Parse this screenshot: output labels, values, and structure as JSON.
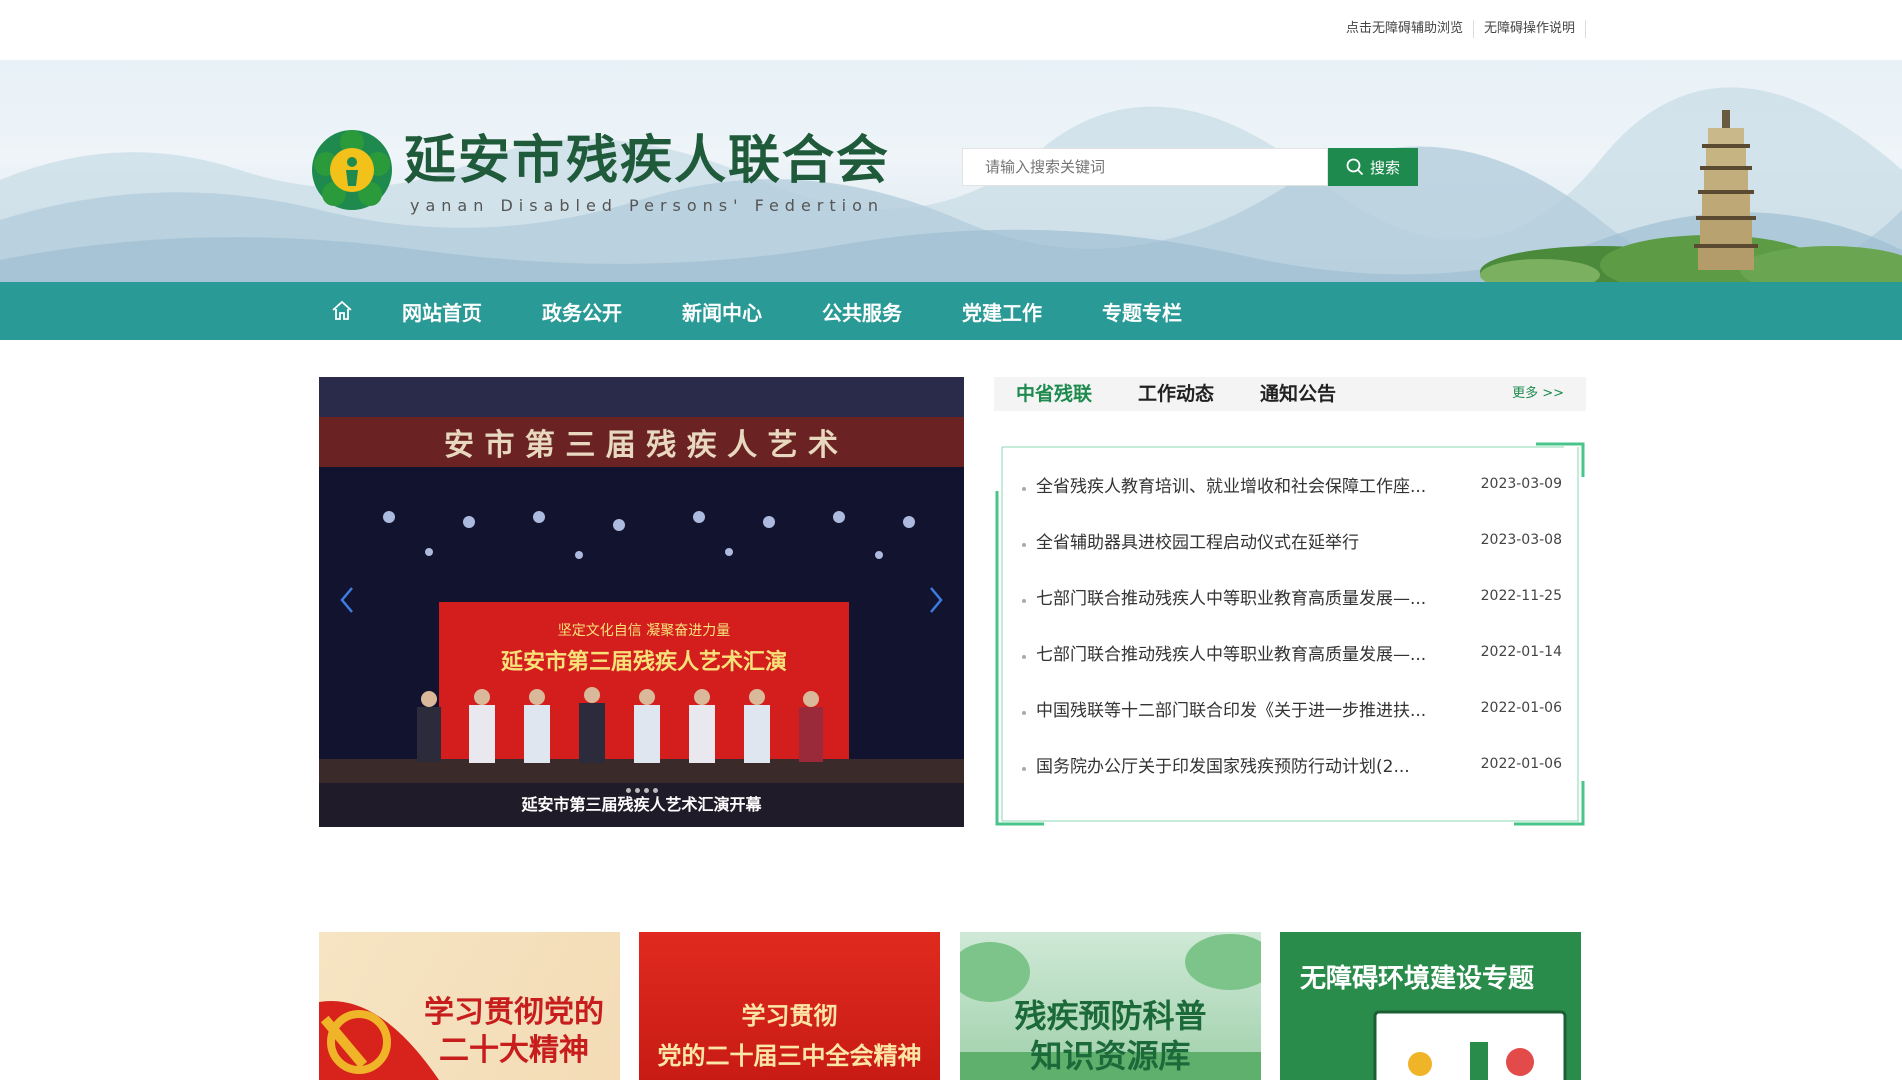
{
  "topbar": {
    "links": [
      "点击无障碍辅助浏览",
      "无障碍操作说明"
    ]
  },
  "header": {
    "title": "延安市残疾人联合会",
    "subtitle": "yanan  Disabled Persons' Federtion",
    "search_placeholder": "请输入搜索关键词",
    "search_button": "搜索"
  },
  "nav": {
    "home_icon": "home-icon",
    "items": [
      "网站首页",
      "政务公开",
      "新闻中心",
      "公共服务",
      "党建工作",
      "专题专栏"
    ]
  },
  "carousel": {
    "caption": "延安市第三届残疾人艺术汇演开幕",
    "banner_text": "安 市 第 三 届 残 疾 人 艺 术",
    "stage_line1": "坚定文化自信      凝聚奋进力量",
    "stage_line2": "延安市第三届残疾人艺术汇演",
    "dots": 4
  },
  "news": {
    "tabs": [
      "中省残联",
      "工作动态",
      "通知公告"
    ],
    "active_tab": 0,
    "more": "更多 >>",
    "items": [
      {
        "title": "全省残疾人教育培训、就业增收和社会保障工作座...",
        "date": "2023-03-09"
      },
      {
        "title": "全省辅助器具进校园工程启动仪式在延举行",
        "date": "2023-03-08"
      },
      {
        "title": "七部门联合推动残疾人中等职业教育高质量发展—...",
        "date": "2022-11-25"
      },
      {
        "title": "七部门联合推动残疾人中等职业教育高质量发展—...",
        "date": "2022-01-14"
      },
      {
        "title": "中国残联等十二部门联合印发《关于进一步推进扶...",
        "date": "2022-01-06"
      },
      {
        "title": "国务院办公厅关于印发国家残疾预防行动计划(2...",
        "date": "2022-01-06"
      }
    ]
  },
  "cards": [
    {
      "line1": "学习贯彻党的",
      "line2": "二十大精神"
    },
    {
      "line1": "学习贯彻",
      "line2": "党的二十届三中全会精神"
    },
    {
      "line1": "残疾预防科普",
      "line2": "知识资源库"
    },
    {
      "line1": "无障碍环境建设专题",
      "line2": ""
    }
  ],
  "colors": {
    "nav": "#2a9a96",
    "brand_green": "#1e8a4e",
    "title_green": "#1f5a3a",
    "party_red": "#d7231b"
  }
}
